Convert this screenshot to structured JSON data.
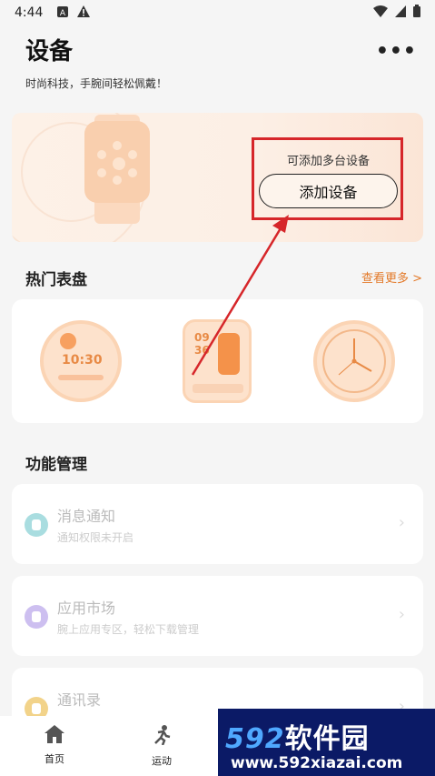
{
  "status_bar": {
    "time": "4:44"
  },
  "header": {
    "title": "设备",
    "subtitle": "时尚科技，手腕间轻松佩戴！",
    "more": "•••"
  },
  "banner": {
    "hint": "可添加多台设备",
    "add_button": "添加设备"
  },
  "watch_faces": {
    "title": "热门表盘",
    "see_more": "查看更多 >"
  },
  "watch_face_texts": {
    "digital_time": "10:30",
    "digital_hour": "09",
    "digital_min": "36"
  },
  "functions": {
    "title": "功能管理",
    "items": [
      {
        "title": "消息通知",
        "subtitle": "通知权限未开启",
        "icon_color": "#a9dde0"
      },
      {
        "title": "应用市场",
        "subtitle": "腕上应用专区，轻松下载管理",
        "icon_color": "#cdbff0"
      },
      {
        "title": "通讯录",
        "subtitle": "",
        "icon_color": "#f2d38a"
      }
    ]
  },
  "bottom_nav": {
    "items": [
      {
        "label": "首页",
        "icon": "home-icon"
      },
      {
        "label": "运动",
        "icon": "running-icon"
      }
    ]
  },
  "watermark": {
    "brand": "软件园",
    "brand_num": "592",
    "url": "www.592xiazai.com"
  },
  "colors": {
    "accent": "#e37a2a",
    "annotation": "#d6262a",
    "watermark_bg": "#0b1a66"
  }
}
